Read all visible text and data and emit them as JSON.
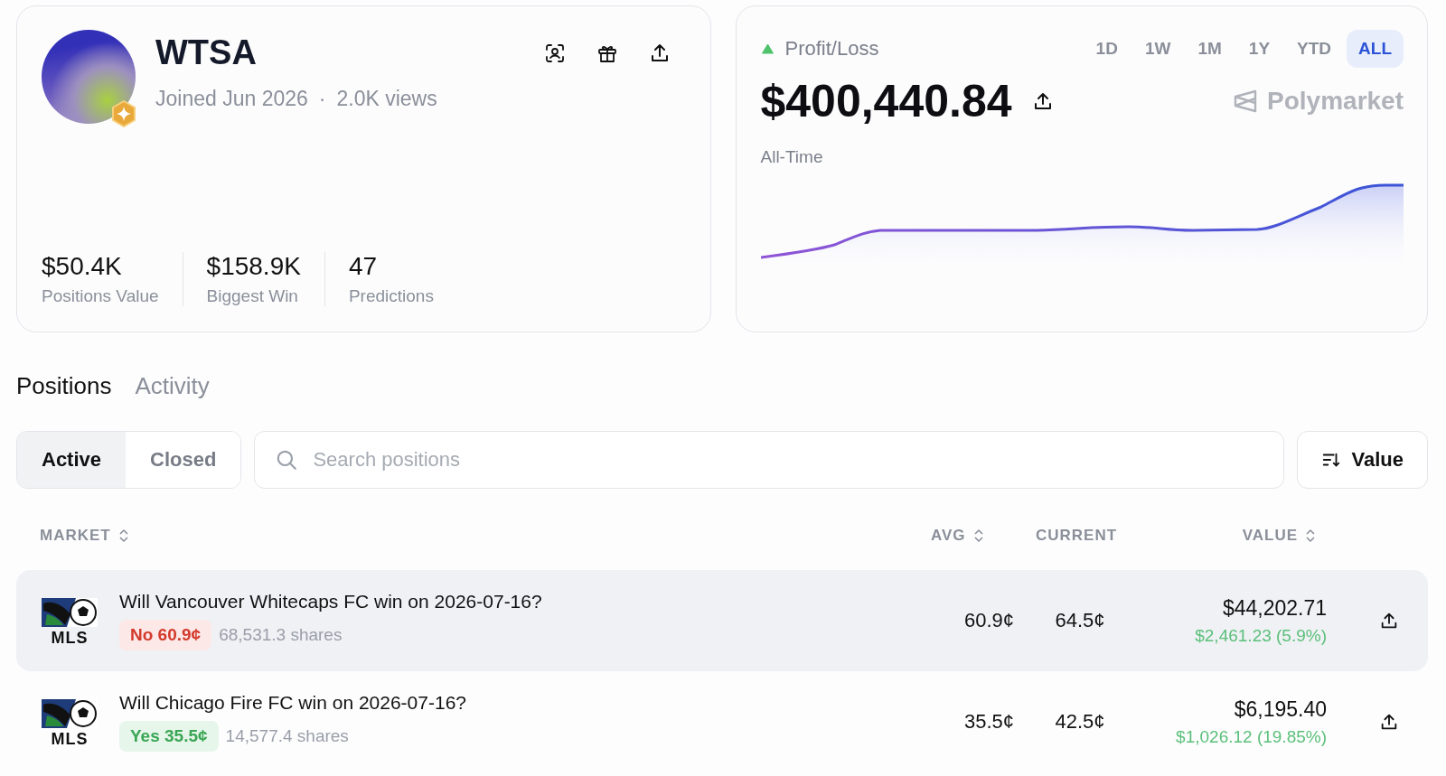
{
  "profile": {
    "name": "WTSA",
    "joined": "Joined Jun 2026",
    "separator": "·",
    "views": "2.0K views",
    "stats": [
      {
        "value": "$50.4K",
        "label": "Positions Value"
      },
      {
        "value": "$158.9K",
        "label": "Biggest Win"
      },
      {
        "value": "47",
        "label": "Predictions"
      }
    ]
  },
  "pnl": {
    "title": "Profit/Loss",
    "amount": "$400,440.84",
    "period_label": "All-Time",
    "brand": "Polymarket",
    "ranges": [
      {
        "label": "1D",
        "selected": false
      },
      {
        "label": "1W",
        "selected": false
      },
      {
        "label": "1M",
        "selected": false
      },
      {
        "label": "1Y",
        "selected": false
      },
      {
        "label": "YTD",
        "selected": false
      },
      {
        "label": "ALL",
        "selected": true
      }
    ]
  },
  "tabs": [
    {
      "label": "Positions",
      "selected": true
    },
    {
      "label": "Activity",
      "selected": false
    }
  ],
  "filters": [
    {
      "label": "Active",
      "selected": true
    },
    {
      "label": "Closed",
      "selected": false
    }
  ],
  "search": {
    "placeholder": "Search positions"
  },
  "sort_button": "Value",
  "table": {
    "columns": [
      {
        "label": "MARKET",
        "sortable": true
      },
      {
        "label": "AVG",
        "sortable": true
      },
      {
        "label": "CURRENT",
        "sortable": false
      },
      {
        "label": "VALUE",
        "sortable": true
      }
    ],
    "rows": [
      {
        "logo_text": "MLS",
        "title": "Will Vancouver Whitecaps FC win on 2026-07-16?",
        "outcome": "No 60.9¢",
        "kind": "no",
        "shares": "68,531.3 shares",
        "avg": "60.9¢",
        "current": "64.5¢",
        "value": "$44,202.71",
        "change": "$2,461.23 (5.9%)",
        "highlighted": true
      },
      {
        "logo_text": "MLS",
        "title": "Will Chicago Fire FC win on 2026-07-16?",
        "outcome": "Yes 35.5¢",
        "kind": "yes",
        "shares": "14,577.4 shares",
        "avg": "35.5¢",
        "current": "42.5¢",
        "value": "$6,195.40",
        "change": "$1,026.12 (19.85%)",
        "highlighted": false
      }
    ]
  }
}
